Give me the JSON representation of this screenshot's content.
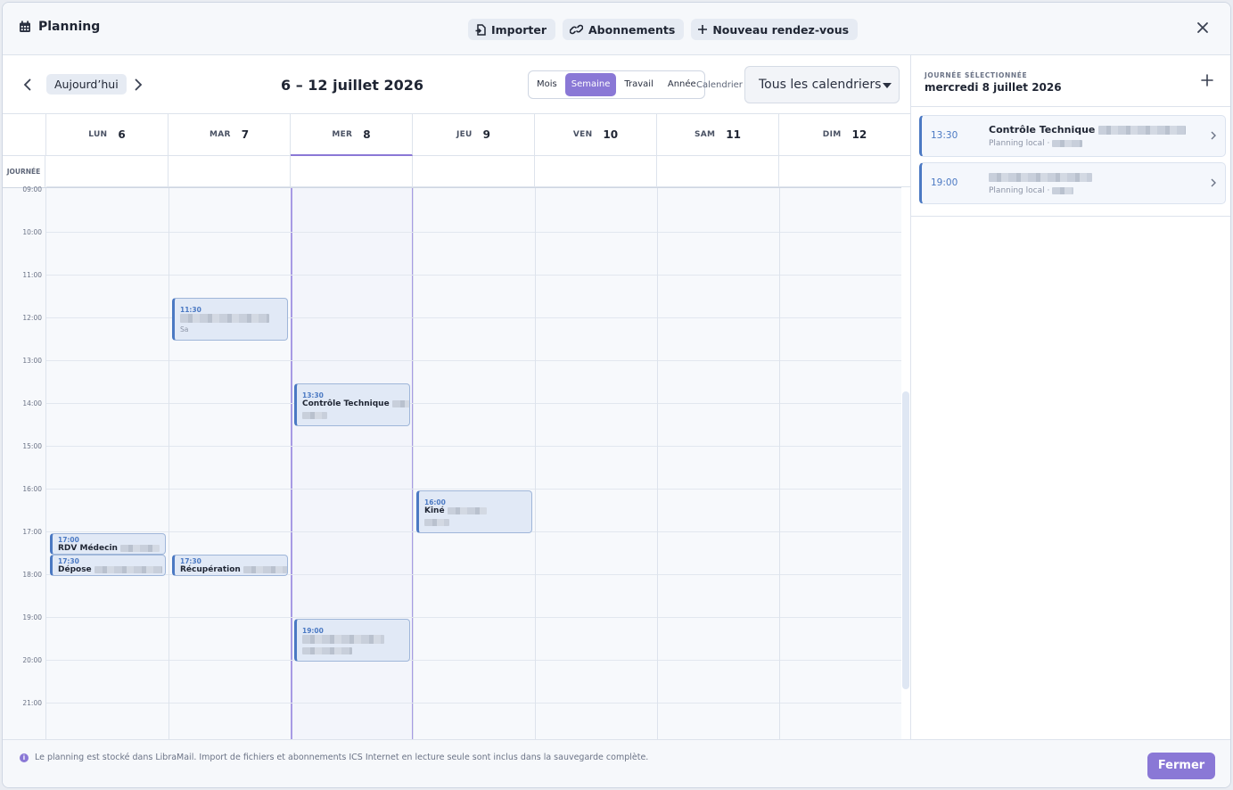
{
  "header": {
    "title": "Planning",
    "buttons": {
      "import": "Importer",
      "subscriptions": "Abonnements",
      "new_event": "Nouveau rendez-vous"
    }
  },
  "toolbar": {
    "today": "Aujourd’hui",
    "range": "6 – 12 juillet 2026",
    "views": [
      "Mois",
      "Semaine",
      "Travail",
      "Année"
    ],
    "active_view": "Semaine",
    "calendar_label": "Calendrier",
    "calendar_value": "Tous les calendriers"
  },
  "grid": {
    "days": [
      {
        "name": "LUN",
        "num": "6"
      },
      {
        "name": "MAR",
        "num": "7"
      },
      {
        "name": "MER",
        "num": "8"
      },
      {
        "name": "JEU",
        "num": "9"
      },
      {
        "name": "VEN",
        "num": "10"
      },
      {
        "name": "SAM",
        "num": "11"
      },
      {
        "name": "DIM",
        "num": "12"
      }
    ],
    "selected_day": "MER 8",
    "allday_label": "JOURNÉE",
    "hours": [
      "09:00",
      "10:00",
      "11:00",
      "12:00",
      "13:00",
      "14:00",
      "15:00",
      "16:00",
      "17:00",
      "18:00",
      "19:00",
      "20:00",
      "21:00"
    ]
  },
  "events": {
    "mar_1130": {
      "time": "11:30",
      "name": "",
      "sub": "Sa"
    },
    "mer_1330": {
      "time": "13:30",
      "name": "Contrôle Technique",
      "sub": ""
    },
    "jeu_1600": {
      "time": "16:00",
      "name": "Kiné",
      "sub": ""
    },
    "lun_1700": {
      "time": "17:00",
      "name": "RDV Médecin",
      "sub": ""
    },
    "lun_1730": {
      "time": "17:30",
      "name": "Dépose",
      "sub": ""
    },
    "mar_1730": {
      "time": "17:30",
      "name": "Récupération",
      "sub": ""
    },
    "mer_1900": {
      "time": "19:00",
      "name": "",
      "sub": ""
    }
  },
  "panel": {
    "label": "JOURNÉE SÉLECTIONNÉE",
    "date": "mercredi 8 juillet 2026",
    "items": [
      {
        "time": "13:30",
        "name": "Contrôle Technique",
        "sub": "Planning local ·"
      },
      {
        "time": "19:00",
        "name": "",
        "sub": "Planning local ·"
      }
    ]
  },
  "footer": {
    "info": "Le planning est stocké dans LibraMail. Import de fichiers et abonnements ICS Internet en lecture seule sont inclus dans la sauvegarde complète.",
    "close": "Fermer"
  },
  "colors": {
    "accent": "#8a78d6",
    "event": "#4b79c3",
    "event_bg": "#e1e9f6"
  }
}
